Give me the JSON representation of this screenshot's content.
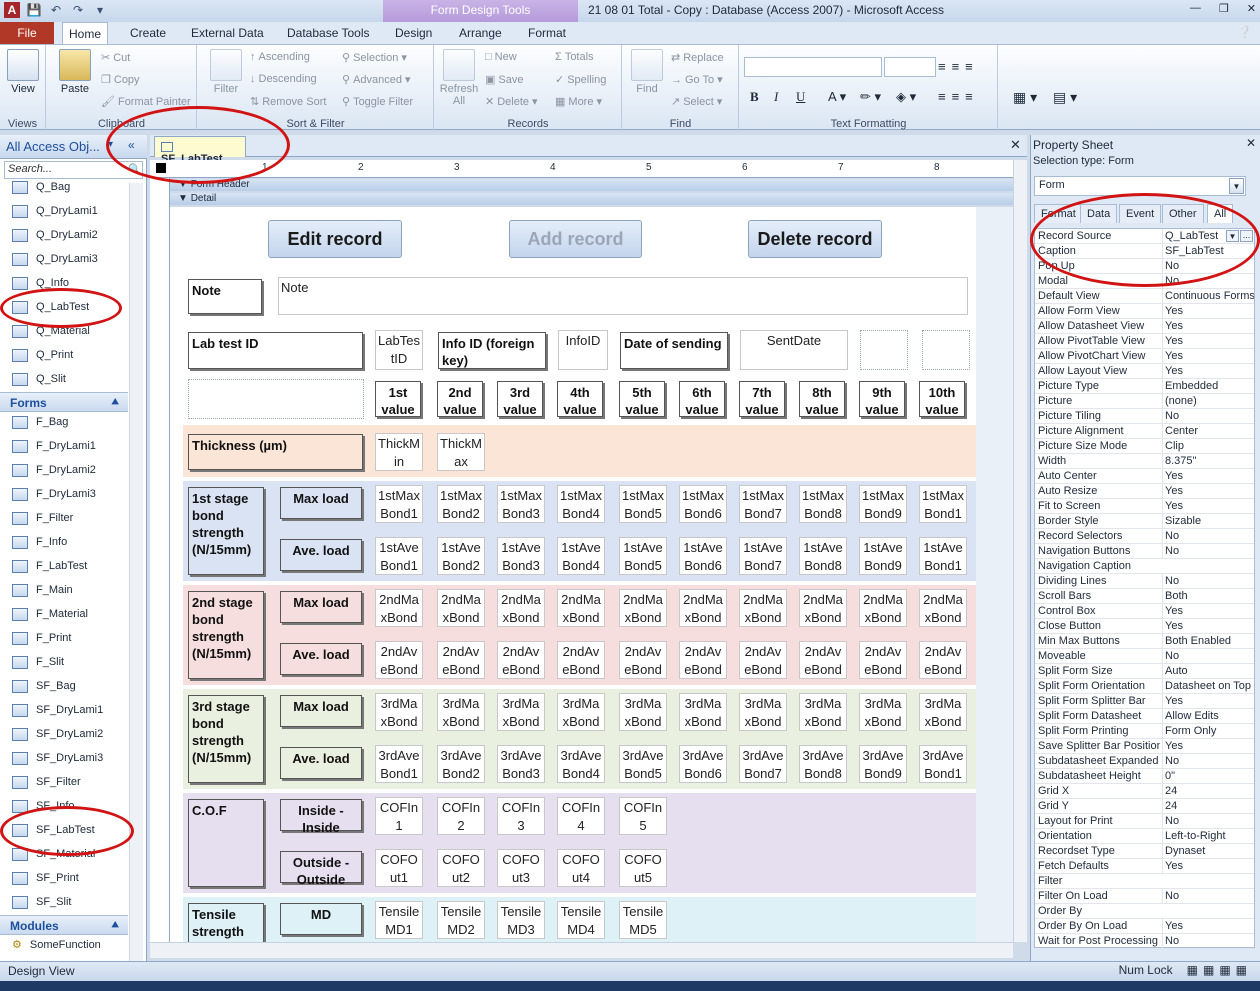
{
  "title": {
    "context_tools": "Form Design Tools",
    "window": "21 08 01 Total - Copy : Database (Access 2007) - Microsoft Access",
    "app_letter": "A"
  },
  "ribbon_tabs": [
    "File",
    "Home",
    "Create",
    "External Data",
    "Database Tools",
    "Design",
    "Arrange",
    "Format"
  ],
  "ribbon": {
    "views": {
      "view": "View",
      "label": "Views"
    },
    "clipboard": {
      "paste": "Paste",
      "cut": "Cut",
      "copy": "Copy",
      "format_painter": "Format Painter",
      "label": "Clipboard"
    },
    "sort_filter": {
      "filter": "Filter",
      "ascending": "Ascending",
      "descending": "Descending",
      "remove_sort": "Remove Sort",
      "selection": "Selection",
      "advanced": "Advanced",
      "toggle_filter": "Toggle Filter",
      "label": "Sort & Filter"
    },
    "records": {
      "refresh": "Refresh All",
      "new": "New",
      "save": "Save",
      "delete": "Delete",
      "totals": "Totals",
      "spelling": "Spelling",
      "more": "More",
      "label": "Records"
    },
    "find": {
      "find": "Find",
      "replace": "Replace",
      "goto": "Go To",
      "select": "Select",
      "label": "Find"
    },
    "text_formatting": {
      "label": "Text Formatting",
      "bold": "B",
      "italic": "I",
      "underline": "U"
    }
  },
  "nav": {
    "header": "All Access Obj...",
    "search_placeholder": "Search...",
    "queries": [
      "Q_Bag",
      "Q_DryLami1",
      "Q_DryLami2",
      "Q_DryLami3",
      "Q_Info",
      "Q_LabTest",
      "Q_Material",
      "Q_Print",
      "Q_Slit"
    ],
    "forms_header": "Forms",
    "forms": [
      "F_Bag",
      "F_DryLami1",
      "F_DryLami2",
      "F_DryLami3",
      "F_Filter",
      "F_Info",
      "F_LabTest",
      "F_Main",
      "F_Material",
      "F_Print",
      "F_Slit",
      "SF_Bag",
      "SF_DryLami1",
      "SF_DryLami2",
      "SF_DryLami3",
      "SF_Filter",
      "SF_Info",
      "SF_LabTest",
      "SF_Material",
      "SF_Print",
      "SF_Slit"
    ],
    "modules_header": "Modules",
    "modules": [
      "SomeFunction"
    ]
  },
  "document": {
    "tab": "SF_LabTest",
    "ruler_numbers": [
      "1",
      "2",
      "3",
      "4",
      "5",
      "6",
      "7",
      "8"
    ],
    "form_header_label": "Form Header",
    "detail_label": "Detail",
    "buttons": {
      "edit": "Edit record",
      "add": "Add record",
      "delete": "Delete record"
    },
    "note_label": "Note",
    "note_value": "Note",
    "labtest_label": "Lab test ID",
    "labtest_box": "LabTestID",
    "info_label": "Info ID (foreign key)",
    "info_box": "InfoID",
    "date_label": "Date of sending",
    "date_box": "SentDate",
    "value_headers": [
      "1st value",
      "2nd value",
      "3rd value",
      "4th value",
      "5th value",
      "6th value",
      "7th value",
      "8th value",
      "9th value",
      "10th value"
    ],
    "thickness_label": "Thickness (µm)",
    "thickness_boxes": [
      "ThickMin",
      "ThickMax"
    ],
    "stage1_label": "1st stage bond strength (N/15mm)",
    "stage2_label": "2nd stage bond strength (N/15mm)",
    "stage3_label": "3rd stage bond strength (N/15mm)",
    "max_load": "Max load",
    "ave_load": "Ave. load",
    "s1_max": [
      "1stMaxBond1",
      "1stMaxBond2",
      "1stMaxBond3",
      "1stMaxBond4",
      "1stMaxBond5",
      "1stMaxBond6",
      "1stMaxBond7",
      "1stMaxBond8",
      "1stMaxBond9",
      "1stMaxBond1"
    ],
    "s1_ave": [
      "1stAveBond1",
      "1stAveBond2",
      "1stAveBond3",
      "1stAveBond4",
      "1stAveBond5",
      "1stAveBond6",
      "1stAveBond7",
      "1stAveBond8",
      "1stAveBond9",
      "1stAveBond1"
    ],
    "s2_max": [
      "2ndMaxBond",
      "2ndMaxBond",
      "2ndMaxBond",
      "2ndMaxBond",
      "2ndMaxBond",
      "2ndMaxBond",
      "2ndMaxBond",
      "2ndMaxBond",
      "2ndMaxBond",
      "2ndMaxBond"
    ],
    "s2_ave": [
      "2ndAveBond",
      "2ndAveBond",
      "2ndAveBond",
      "2ndAveBond",
      "2ndAveBond",
      "2ndAveBond",
      "2ndAveBond",
      "2ndAveBond",
      "2ndAveBond",
      "2ndAveBond"
    ],
    "s3_max": [
      "3rdMaxBond",
      "3rdMaxBond",
      "3rdMaxBond",
      "3rdMaxBond",
      "3rdMaxBond",
      "3rdMaxBond",
      "3rdMaxBond",
      "3rdMaxBond",
      "3rdMaxBond",
      "3rdMaxBond"
    ],
    "s3_ave": [
      "3rdAveBond1",
      "3rdAveBond2",
      "3rdAveBond3",
      "3rdAveBond4",
      "3rdAveBond5",
      "3rdAveBond6",
      "3rdAveBond7",
      "3rdAveBond8",
      "3rdAveBond9",
      "3rdAveBond1"
    ],
    "cof_label": "C.O.F",
    "cof_inside": "Inside - Inside",
    "cof_outside": "Outside - Outside",
    "cof_in": [
      "COFIn1",
      "COFIn2",
      "COFIn3",
      "COFIn4",
      "COFIn5"
    ],
    "cof_out": [
      "COFOut1",
      "COFOut2",
      "COFOut3",
      "COFOut4",
      "COFOut5"
    ],
    "tensile_label": "Tensile strength",
    "md_label": "MD",
    "tensile": [
      "TensileMD1",
      "TensileMD2",
      "TensileMD3",
      "TensileMD4",
      "TensileMD5"
    ],
    "band_colors": {
      "thickness": "#fbe5d6",
      "stage1": "#dae3f3",
      "stage2": "#f7dede",
      "stage3": "#e9f0df",
      "cof": "#e6dff0",
      "tensile": "#ddf1f6"
    }
  },
  "property_sheet": {
    "title": "Property Sheet",
    "selection_type": "Selection type:  Form",
    "combo": "Form",
    "tabs": [
      "Format",
      "Data",
      "Event",
      "Other",
      "All"
    ],
    "rows": [
      [
        "Record Source",
        "Q_LabTest"
      ],
      [
        "Caption",
        "SF_LabTest"
      ],
      [
        "Pop Up",
        "No"
      ],
      [
        "Modal",
        "No"
      ],
      [
        "Default View",
        "Continuous Forms"
      ],
      [
        "Allow Form View",
        "Yes"
      ],
      [
        "Allow Datasheet View",
        "Yes"
      ],
      [
        "Allow PivotTable View",
        "Yes"
      ],
      [
        "Allow PivotChart View",
        "Yes"
      ],
      [
        "Allow Layout View",
        "Yes"
      ],
      [
        "Picture Type",
        "Embedded"
      ],
      [
        "Picture",
        "(none)"
      ],
      [
        "Picture Tiling",
        "No"
      ],
      [
        "Picture Alignment",
        "Center"
      ],
      [
        "Picture Size Mode",
        "Clip"
      ],
      [
        "Width",
        "8.375\""
      ],
      [
        "Auto Center",
        "Yes"
      ],
      [
        "Auto Resize",
        "Yes"
      ],
      [
        "Fit to Screen",
        "Yes"
      ],
      [
        "Border Style",
        "Sizable"
      ],
      [
        "Record Selectors",
        "No"
      ],
      [
        "Navigation Buttons",
        "No"
      ],
      [
        "Navigation Caption",
        ""
      ],
      [
        "Dividing Lines",
        "No"
      ],
      [
        "Scroll Bars",
        "Both"
      ],
      [
        "Control Box",
        "Yes"
      ],
      [
        "Close Button",
        "Yes"
      ],
      [
        "Min Max Buttons",
        "Both Enabled"
      ],
      [
        "Moveable",
        "No"
      ],
      [
        "Split Form Size",
        "Auto"
      ],
      [
        "Split Form Orientation",
        "Datasheet on Top"
      ],
      [
        "Split Form Splitter Bar",
        "Yes"
      ],
      [
        "Split Form Datasheet",
        "Allow Edits"
      ],
      [
        "Split Form Printing",
        "Form Only"
      ],
      [
        "Save Splitter Bar Position",
        "Yes"
      ],
      [
        "Subdatasheet Expanded",
        "No"
      ],
      [
        "Subdatasheet Height",
        "0\""
      ],
      [
        "Grid X",
        "24"
      ],
      [
        "Grid Y",
        "24"
      ],
      [
        "Layout for Print",
        "No"
      ],
      [
        "Orientation",
        "Left-to-Right"
      ],
      [
        "Recordset Type",
        "Dynaset"
      ],
      [
        "Fetch Defaults",
        "Yes"
      ],
      [
        "Filter",
        ""
      ],
      [
        "Filter On Load",
        "No"
      ],
      [
        "Order By",
        ""
      ],
      [
        "Order By On Load",
        "Yes"
      ],
      [
        "Wait for Post Processing",
        "No"
      ]
    ]
  },
  "status": {
    "left": "Design View",
    "num_lock": "Num Lock"
  }
}
